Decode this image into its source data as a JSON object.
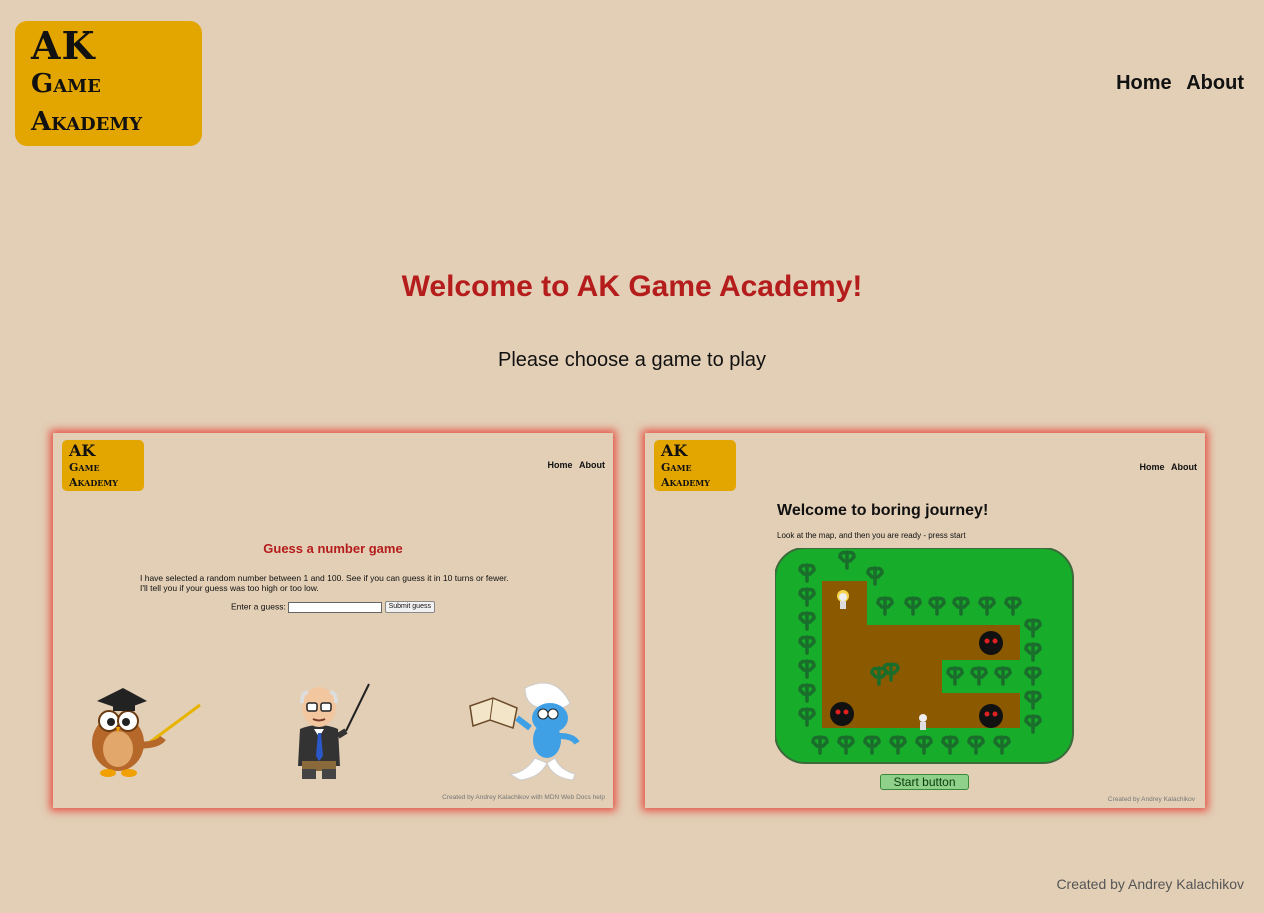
{
  "logo": {
    "line1": "AK",
    "line2": "Game",
    "line3": "Akademy"
  },
  "nav": {
    "home": "Home",
    "about": "About"
  },
  "main": {
    "title": "Welcome to AK Game Academy!",
    "subtitle": "Please choose a game to play"
  },
  "cards": [
    {
      "logo": {
        "line1": "AK",
        "line2": "Game",
        "line3": "Akademy"
      },
      "nav": {
        "home": "Home",
        "about": "About"
      },
      "title": "Guess a number game",
      "text1": "I have selected a random number between 1 and 100. See if you can guess it in 10 turns or fewer.",
      "text2": "I'll tell you if your guess was too high or too low.",
      "input_label": "Enter a guess:",
      "submit_label": "Submit guess",
      "footer": "Created by Andrey Kalachikov with MDN Web Docs help"
    },
    {
      "logo": {
        "line1": "AK",
        "line2": "Game",
        "line3": "Akademy"
      },
      "nav": {
        "home": "Home",
        "about": "About"
      },
      "title": "Welcome to boring journey!",
      "text": "Look at the map, and then you are ready - press start",
      "start_label": "Start button",
      "footer": "Created by Andrey Kalachikov"
    }
  ],
  "footer": "Created by Andrey Kalachikov",
  "colors": {
    "background": "#e2cfb6",
    "logo": "#e3a600",
    "title": "#b51c1c",
    "card_glow": "#e63c32",
    "map_green": "#17ac2a",
    "map_path": "#8b5a00"
  },
  "icons": [
    "owl-teacher-icon",
    "professor-icon",
    "smurf-reader-icon",
    "tree-icon",
    "enemy-face-icon",
    "player-icon"
  ]
}
